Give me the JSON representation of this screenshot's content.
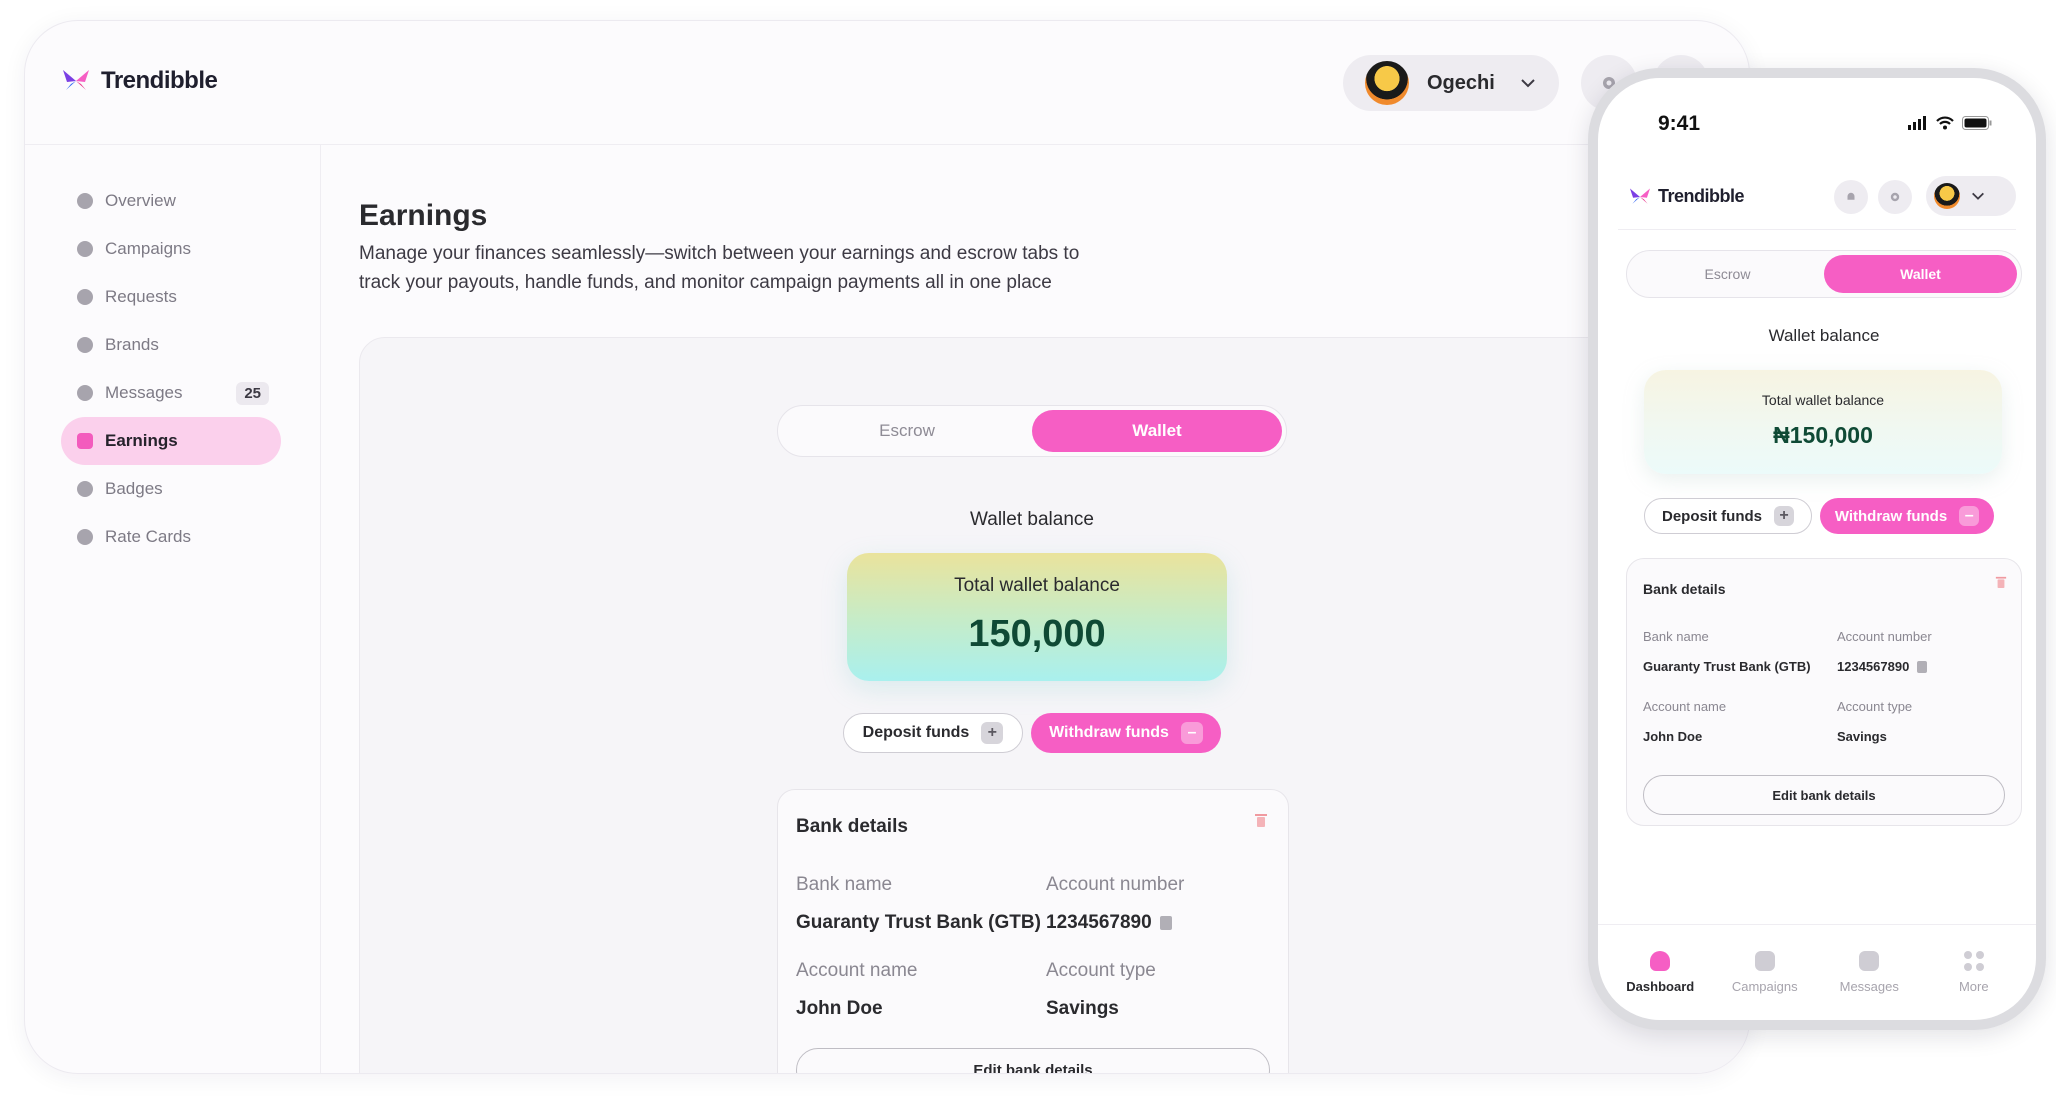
{
  "brand": {
    "name": "Trendibble"
  },
  "user": {
    "name": "Ogechi"
  },
  "sidebar": {
    "items": [
      {
        "label": "Overview",
        "icon": "home-icon"
      },
      {
        "label": "Campaigns",
        "icon": "chart-icon"
      },
      {
        "label": "Requests",
        "icon": "check-circle-icon"
      },
      {
        "label": "Brands",
        "icon": "users-icon"
      },
      {
        "label": "Messages",
        "icon": "message-icon",
        "badge": "25"
      },
      {
        "label": "Earnings",
        "icon": "wallet-icon",
        "active": true
      },
      {
        "label": "Badges",
        "icon": "badge-icon"
      },
      {
        "label": "Rate Cards",
        "icon": "card-icon"
      }
    ]
  },
  "page": {
    "title": "Earnings",
    "subtitle": "Manage your finances seamlessly—switch between your earnings and escrow tabs to track your payouts, handle funds, and monitor campaign payments all in one place"
  },
  "tabs": {
    "escrow": "Escrow",
    "wallet": "Wallet",
    "active": "Wallet"
  },
  "wallet": {
    "label": "Wallet balance",
    "card_title": "Total wallet balance",
    "amount": "150,000",
    "amount_mobile": "₦150,000",
    "deposit": "Deposit funds",
    "withdraw": "Withdraw funds",
    "deposit_symbol": "+",
    "withdraw_symbol": "–"
  },
  "bank": {
    "title": "Bank details",
    "bank_name_label": "Bank name",
    "bank_name": "Guaranty Trust Bank (GTB)",
    "account_number_label": "Account number",
    "account_number": "1234567890",
    "account_name_label": "Account name",
    "account_name": "John Doe",
    "account_type_label": "Account type",
    "account_type": "Savings",
    "edit_label": "Edit bank details"
  },
  "mobile": {
    "time": "9:41",
    "bottom_nav": [
      {
        "label": "Dashboard",
        "icon": "home-icon",
        "active": true
      },
      {
        "label": "Campaigns",
        "icon": "chart-icon"
      },
      {
        "label": "Messages",
        "icon": "message-icon"
      },
      {
        "label": "More",
        "icon": "grid-icon"
      }
    ]
  },
  "colors": {
    "accent": "#f65ec4",
    "accent_soft": "#fbd0ec",
    "balance_text": "#0f4a35",
    "text": "#2a2a2e",
    "muted": "#8a8791"
  }
}
